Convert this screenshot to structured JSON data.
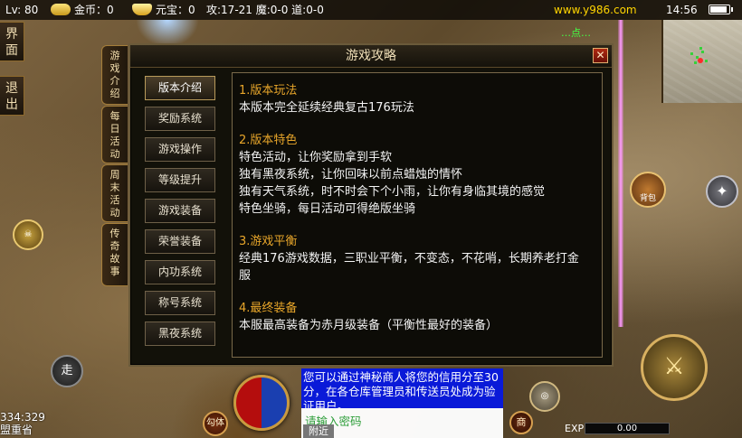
{
  "topbar": {
    "level": "Lv: 80",
    "gold_label": "金币：0",
    "yuanbao_label": "元宝：0",
    "stats": "攻:17-21  魔:0-0  道:0-0",
    "site": "www.y986.com",
    "time": "14:56",
    "icons": [
      "gold-coins-icon",
      "yuanbao-ingot-icon",
      "battery-icon"
    ]
  },
  "side_buttons": [
    "界面",
    "退出"
  ],
  "side_tabs": [
    "游戏介绍",
    "每日活动",
    "周末活动",
    "传奇故事"
  ],
  "npc_tag": "…点…",
  "panel": {
    "title": "游戏攻略",
    "close": "✕",
    "nav": [
      {
        "label": "版本介绍",
        "active": true
      },
      {
        "label": "奖励系统",
        "active": false
      },
      {
        "label": "游戏操作",
        "active": false
      },
      {
        "label": "等级提升",
        "active": false
      },
      {
        "label": "游戏装备",
        "active": false
      },
      {
        "label": "荣誉装备",
        "active": false
      },
      {
        "label": "内功系统",
        "active": false
      },
      {
        "label": "称号系统",
        "active": false
      },
      {
        "label": "黑夜系统",
        "active": false
      }
    ],
    "sections": [
      {
        "heading": "1.版本玩法",
        "lines": [
          "本版本完全延续经典复古176玩法"
        ]
      },
      {
        "heading": "2.版本特色",
        "lines": [
          "特色活动，让你奖励拿到手软",
          "独有黑夜系统，让你回味以前点蜡烛的情怀",
          "独有天气系统，时不时会下个小雨，让你有身临其境的感觉",
          "特色坐骑，每日活动可得绝版坐骑"
        ]
      },
      {
        "heading": "3.游戏平衡",
        "lines": [
          "经典176游戏数据，三职业平衡，不变态，不花哨，长期养老打金服"
        ]
      },
      {
        "heading": "4.最终装备",
        "lines": [
          "本服最高装备为赤月级装备（平衡性最好的装备）"
        ]
      }
    ]
  },
  "chat": {
    "message": "您可以通过神秘商人将您的信用分至30分，在各仓库管理员和传送员处成为验证用户。",
    "password_prompt": "请输入密码",
    "recent": "附近"
  },
  "controls": {
    "walk": "走",
    "attack": "勾体",
    "shop": "商",
    "bag": "背包",
    "star": "✦",
    "sword": "⚔",
    "skill_small": "◎",
    "skill_left": "☠"
  },
  "bottom": {
    "coords": "334:329",
    "map_name": "盟重省",
    "exp_label": "EXP",
    "exp_value": "0.00"
  },
  "colors": {
    "heading": "#e8a62a",
    "site": "#ffd400",
    "chat_bg": "#0a1ad8",
    "hp": "#b40d0d",
    "mp": "#1a3fb0"
  }
}
